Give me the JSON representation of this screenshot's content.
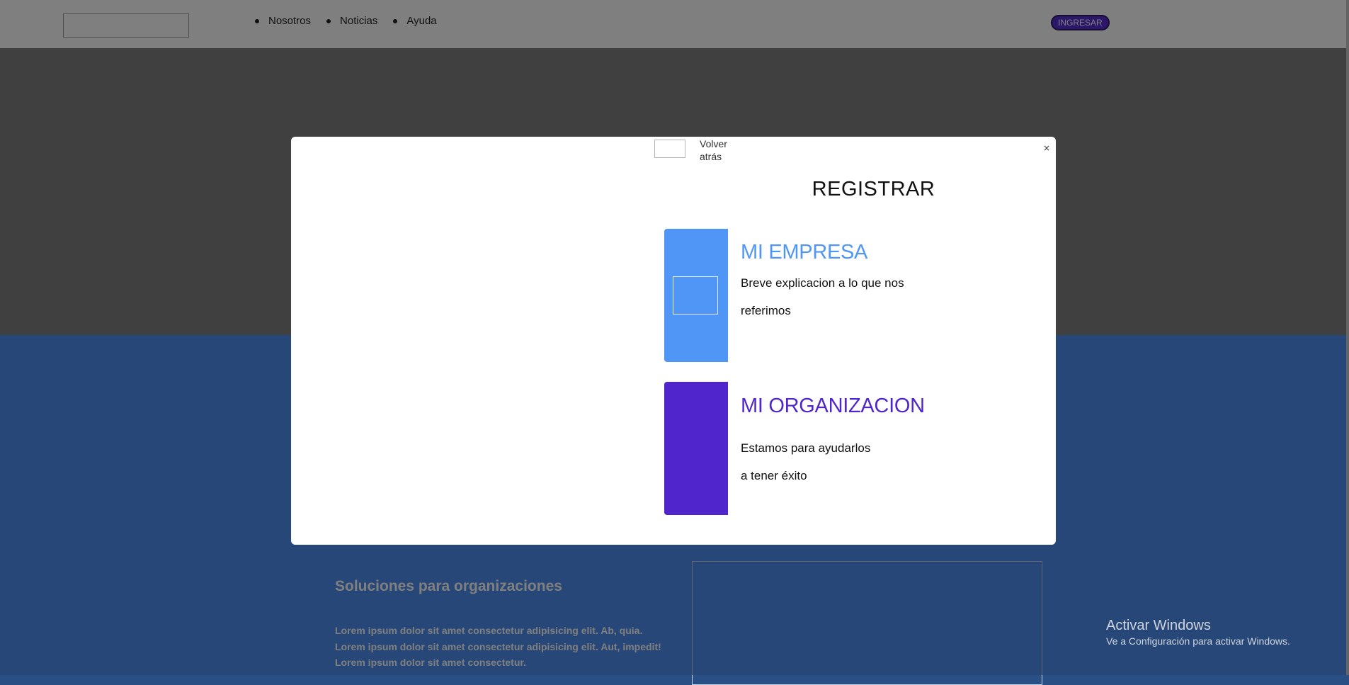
{
  "header": {
    "nav": [
      "Nosotros",
      "Noticias",
      "Ayuda"
    ],
    "login_label": "INGRESAR"
  },
  "page": {
    "solutions_title": "Soluciones para organizaciones",
    "solutions_text": [
      "Lorem ipsum dolor sit amet consectetur adipisicing elit. Ab, quia.",
      "Lorem ipsum dolor sit amet consectetur adipisicing elit. Aut, impedit!",
      "Lorem ipsum dolor sit amet consectetur."
    ]
  },
  "modal": {
    "close_label": "×",
    "back_label": "Volver atrás",
    "title": "REGISTRAR",
    "cards": [
      {
        "title": "MI EMPRESA",
        "lines": [
          "Breve explicacion a lo que nos",
          "referimos"
        ],
        "color": "#4f96f6"
      },
      {
        "title": "MI ORGANIZACION",
        "lines": [
          "Estamos para ayudarlos",
          "a tener éxito"
        ],
        "color": "#5025cc"
      }
    ]
  },
  "windows_activation": {
    "title": "Activar Windows",
    "subtitle": "Ve a Configuración para activar Windows."
  },
  "colors": {
    "backdrop": "rgba(0,0,0,0.5)",
    "blue_section": "#4f8ff0",
    "login_button": "#5a2fd6"
  }
}
